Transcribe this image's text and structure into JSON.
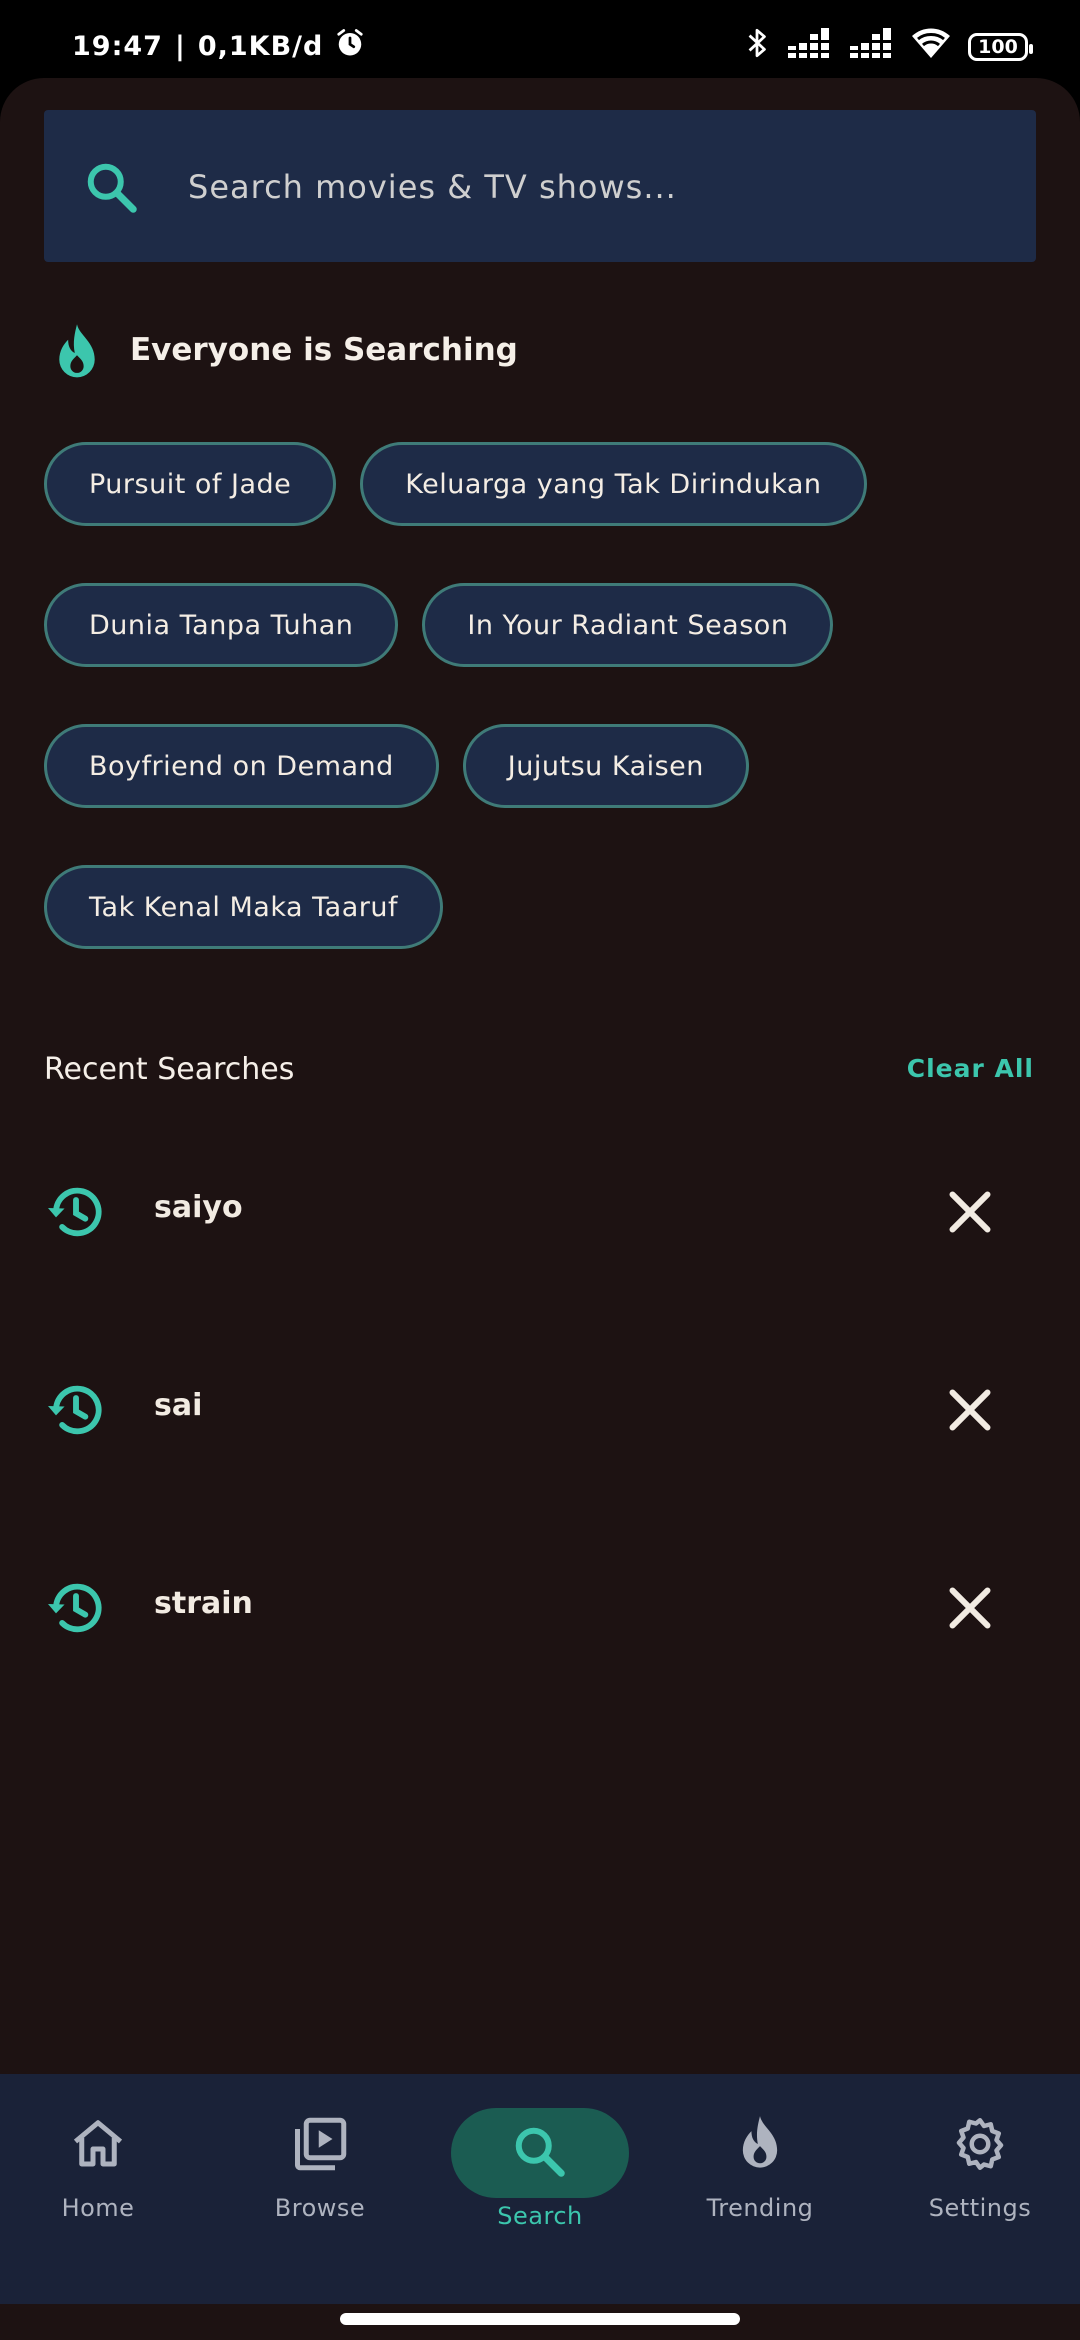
{
  "status_bar": {
    "time": "19:47",
    "separator": "|",
    "network_speed": "0,1KB/d",
    "battery": "100",
    "icons": [
      "alarm-icon",
      "bluetooth-icon",
      "signal-icon",
      "signal-icon",
      "wifi-icon",
      "battery-icon"
    ]
  },
  "search": {
    "placeholder": "Search movies & TV shows...",
    "icon": "search-icon"
  },
  "trending_section": {
    "title": "Everyone is Searching",
    "icon": "flame-icon",
    "chips": [
      [
        "Pursuit of Jade",
        "Keluarga yang Tak Dirindukan"
      ],
      [
        "Dunia Tanpa Tuhan",
        "In Your Radiant Season"
      ],
      [
        "Boyfriend on Demand",
        "Jujutsu Kaisen"
      ],
      [
        "Tak Kenal Maka Taaruf"
      ]
    ]
  },
  "recent": {
    "title": "Recent Searches",
    "clear_all": "Clear All",
    "items": [
      {
        "label": "saiyo"
      },
      {
        "label": "sai"
      },
      {
        "label": "strain"
      }
    ]
  },
  "bottom_nav": {
    "items": [
      {
        "label": "Home",
        "icon": "home-icon"
      },
      {
        "label": "Browse",
        "icon": "browse-icon"
      },
      {
        "label": "Search",
        "icon": "search-icon",
        "active": true
      },
      {
        "label": "Trending",
        "icon": "flame-icon"
      },
      {
        "label": "Settings",
        "icon": "gear-icon"
      }
    ]
  },
  "colors": {
    "background": "#1d1212",
    "surface": "#1e2b47",
    "accent": "#3cc6ad",
    "nav_background": "#1a2238",
    "active_pill": "#1b5c52"
  }
}
